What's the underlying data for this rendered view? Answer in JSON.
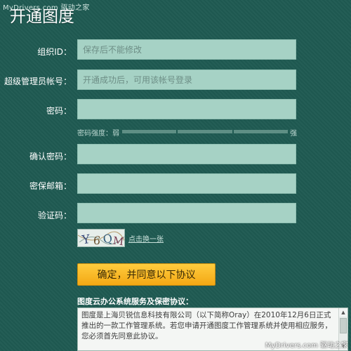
{
  "watermark_top": "MyDrivers.com 驱动之家",
  "page_title": "开通图度",
  "form": {
    "org_id": {
      "label": "组织ID：",
      "placeholder": "保存后不能修改"
    },
    "admin_account": {
      "label": "超级管理员帐号：",
      "placeholder": "开通成功后，可用该帐号登录"
    },
    "password": {
      "label": "密码：",
      "placeholder": ""
    },
    "password_strength": {
      "label": "密码强度：弱",
      "strong_label": "强",
      "level": 0
    },
    "confirm_password": {
      "label": "确认密码：",
      "placeholder": ""
    },
    "security_email": {
      "label": "密保邮箱：",
      "placeholder": ""
    },
    "captcha": {
      "label": "验证码：",
      "placeholder": "",
      "image_text": "Y6QM",
      "refresh_label": "点击换一张"
    }
  },
  "confirm_button": "确定，并同意以下协议",
  "agreement": {
    "title": "图度云办公系统服务及保密协议：",
    "text": "图度是上海贝锐信息科技有限公司（以下简称Oray）在2010年12月6日正式推出的一款工作管理系统。若您申请开通图度工作管理系统并使用相应服务，您必须首先同意此协议。"
  },
  "watermark_bottom": "MyDrivers.com 驱动之家",
  "colors": {
    "background": "#1f5a52",
    "field": "#a6d2c5",
    "button": "#f3a814"
  }
}
